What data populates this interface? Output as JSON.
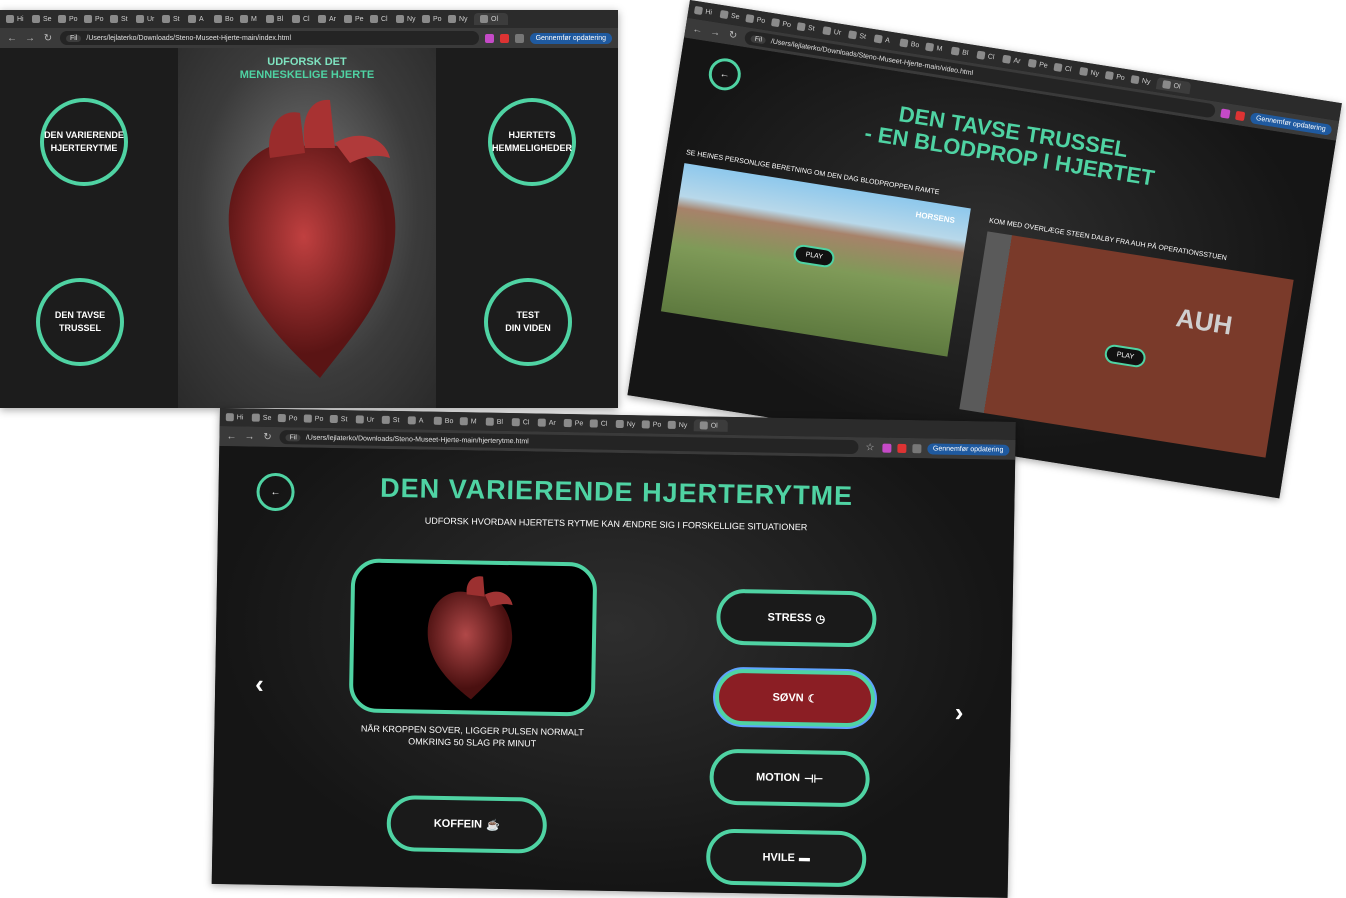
{
  "screen1": {
    "tabs": [
      "Hi",
      "Se",
      "Po",
      "Po",
      "St",
      "Ur",
      "St",
      "A",
      "Bo",
      "M",
      "Bl",
      "Cl",
      "Ar",
      "Pe",
      "Cl",
      "Ny",
      "Po",
      "Ny",
      "Ol"
    ],
    "url": "/Users/lejlaterko/Downloads/Steno-Museet-Hjerte-main/index.html",
    "url_chip": "Fil",
    "update_label": "Gennemfør opdatering",
    "title_line1": "UDFORSK DET",
    "title_line2": "MENNESKELIGE HJERTE",
    "nav": {
      "variable_rhythm": "DEN VARIERENDE HJERTERYTME",
      "heart_secrets": "HJERTETS HEMMELIGHEDER",
      "silent_threat": "DEN TAVSE TRUSSEL",
      "test_line1": "TEST",
      "test_line2": "DIN VIDEN"
    }
  },
  "screen2": {
    "url": "/Users/lejlaterko/Downloads/Steno-Museet-Hjerte-main/video.html",
    "url_chip": "Fil",
    "update_label": "Gennemfør opdatering",
    "back_label": "←",
    "title_line1": "DEN TAVSE TRUSSEL",
    "title_line2": "- EN BLODPROP I HJERTET",
    "video1_caption": "SE HEINES PERSONLIGE BERETNING OM DEN DAG BLODPROPPEN RAMTE",
    "video1_watermark": "HORSENS",
    "video2_caption": "KOM MED OVERLÆGE STEEN DALBY FRA AUH PÅ OPERATIONSSTUEN",
    "video2_sign": "AUH",
    "play_label": "PLAY"
  },
  "screen3": {
    "url": "/Users/lejlaterko/Downloads/Steno-Museet-Hjerte-main/hjerterytme.html",
    "url_chip": "Fil",
    "update_label": "Gennemfør opdatering",
    "back_label": "←",
    "title": "DEN VARIERENDE HJERTERYTME",
    "subtitle": "UDFORSK HVORDAN HJERTETS RYTME KAN ÆNDRE SIG I FORSKELLIGE SITUATIONER",
    "description_line1": "NÅR KROPPEN SOVER, LIGGER PULSEN NORMALT",
    "description_line2": "OMKRING 50 SLAG PR MINUT",
    "prev": "‹",
    "next": "›",
    "buttons": {
      "stress": "STRESS",
      "sleep": "SØVN",
      "exercise": "MOTION",
      "rest": "HVILE",
      "caffeine": "KOFFEIN"
    },
    "selected": "SØVN"
  },
  "colors": {
    "accent": "#4fd3a3",
    "selected": "#8b1e24",
    "background": "#161616"
  }
}
